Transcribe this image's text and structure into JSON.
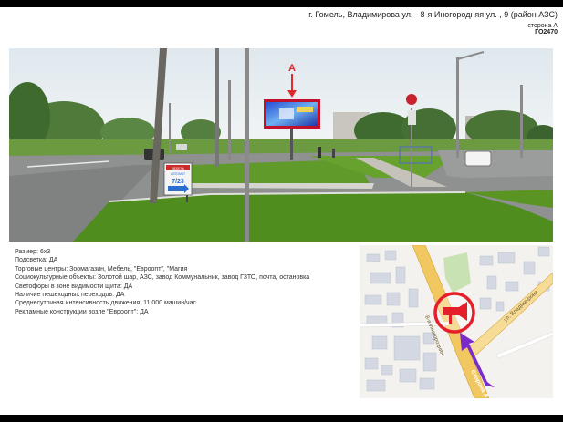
{
  "header": {
    "address": "г. Гомель, Владимирова ул. - 8-я Иногородняя ул. , 9 (район АЗС)",
    "side": "сторона А",
    "code": "ГО2470"
  },
  "photo": {
    "marker_label": "А",
    "sign_text_1": "МЕБЕЛЬ",
    "sign_text_2": "АВТОМАТ",
    "sign_text_3": "7/23"
  },
  "details": [
    "Размер: 6х3",
    "Подсветка: ДА",
    "Торговые центры: Зоомагазин, Мебель, \"Евроопт\", \"Магия",
    "Социокультурные объекты: Золотой шар, АЗС, завод Коммунальник,  завод ГЗТО, почта, остановка",
    "Светофоры в зоне видимости щита: ДА",
    "Наличие пешеходных переходов: ДА",
    "Среднесуточная интенсивность движения: 11 000 машин/час",
    "Рекламные конструкции возле \"Евроопт\": ДА"
  ],
  "map": {
    "street_1": "8-я Иногородняя",
    "street_2": "ул. Владимирова",
    "side_label": "Сторона А"
  },
  "colors": {
    "road_map": "#f1c761",
    "building_map": "#d3d8e3",
    "marker_red": "#e41e2a",
    "arrow_purple": "#7a2bc9"
  }
}
